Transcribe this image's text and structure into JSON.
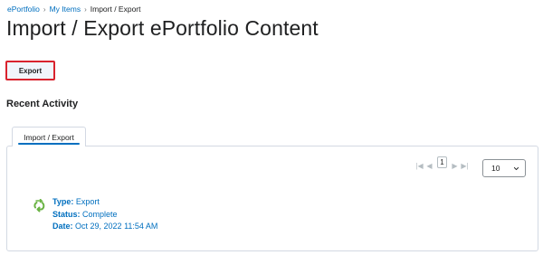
{
  "breadcrumb": {
    "items": [
      "ePortfolio",
      "My Items",
      "Import / Export"
    ],
    "separator": "›"
  },
  "page": {
    "title": "Import / Export ePortfolio Content"
  },
  "toolbar": {
    "export_label": "Export"
  },
  "recent_activity": {
    "title": "Recent Activity",
    "tab_label": "Import / Export"
  },
  "pager": {
    "current_page": "1",
    "per_page": "10"
  },
  "activity": {
    "type_label": "Type:",
    "type_value": "Export",
    "status_label": "Status:",
    "status_value": "Complete",
    "date_label": "Date:",
    "date_value": "Oct 29, 2022 11:54 AM",
    "icon": "export-complete-icon"
  },
  "colors": {
    "link": "#006fbf",
    "highlight_border": "#d9232e",
    "icon_green": "#6ab344"
  }
}
